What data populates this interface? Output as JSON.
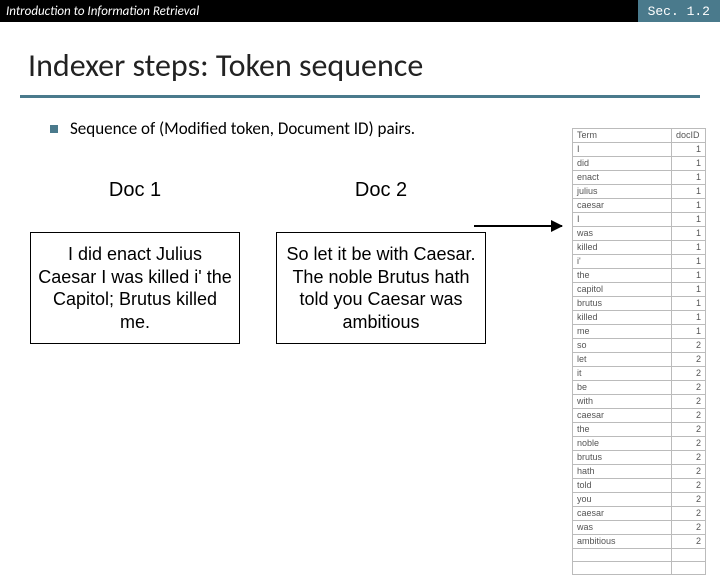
{
  "header": {
    "left": "Introduction to Information Retrieval",
    "right": "Sec. 1.2"
  },
  "title": "Indexer steps: Token sequence",
  "bullet": "Sequence of (Modified token, Document ID) pairs.",
  "docs": {
    "doc1": {
      "heading": "Doc 1",
      "text": "I did enact Julius Caesar I was killed i' the Capitol; Brutus killed me."
    },
    "doc2": {
      "heading": "Doc 2",
      "text": "So let it be with Caesar. The noble Brutus hath told you Caesar was ambitious"
    }
  },
  "table": {
    "headers": {
      "term": "Term",
      "docid": "docID"
    },
    "rows": [
      {
        "term": "I",
        "docid": "1"
      },
      {
        "term": "did",
        "docid": "1"
      },
      {
        "term": "enact",
        "docid": "1"
      },
      {
        "term": "julius",
        "docid": "1"
      },
      {
        "term": "caesar",
        "docid": "1"
      },
      {
        "term": "I",
        "docid": "1"
      },
      {
        "term": "was",
        "docid": "1"
      },
      {
        "term": "killed",
        "docid": "1"
      },
      {
        "term": "i'",
        "docid": "1"
      },
      {
        "term": "the",
        "docid": "1"
      },
      {
        "term": "capitol",
        "docid": "1"
      },
      {
        "term": "brutus",
        "docid": "1"
      },
      {
        "term": "killed",
        "docid": "1"
      },
      {
        "term": "me",
        "docid": "1"
      },
      {
        "term": "so",
        "docid": "2"
      },
      {
        "term": "let",
        "docid": "2"
      },
      {
        "term": "it",
        "docid": "2"
      },
      {
        "term": "be",
        "docid": "2"
      },
      {
        "term": "with",
        "docid": "2"
      },
      {
        "term": "caesar",
        "docid": "2"
      },
      {
        "term": "the",
        "docid": "2"
      },
      {
        "term": "noble",
        "docid": "2"
      },
      {
        "term": "brutus",
        "docid": "2"
      },
      {
        "term": "hath",
        "docid": "2"
      },
      {
        "term": "told",
        "docid": "2"
      },
      {
        "term": "you",
        "docid": "2"
      },
      {
        "term": "caesar",
        "docid": "2"
      },
      {
        "term": "was",
        "docid": "2"
      },
      {
        "term": "ambitious",
        "docid": "2"
      },
      {
        "term": "",
        "docid": ""
      },
      {
        "term": "",
        "docid": ""
      }
    ]
  }
}
